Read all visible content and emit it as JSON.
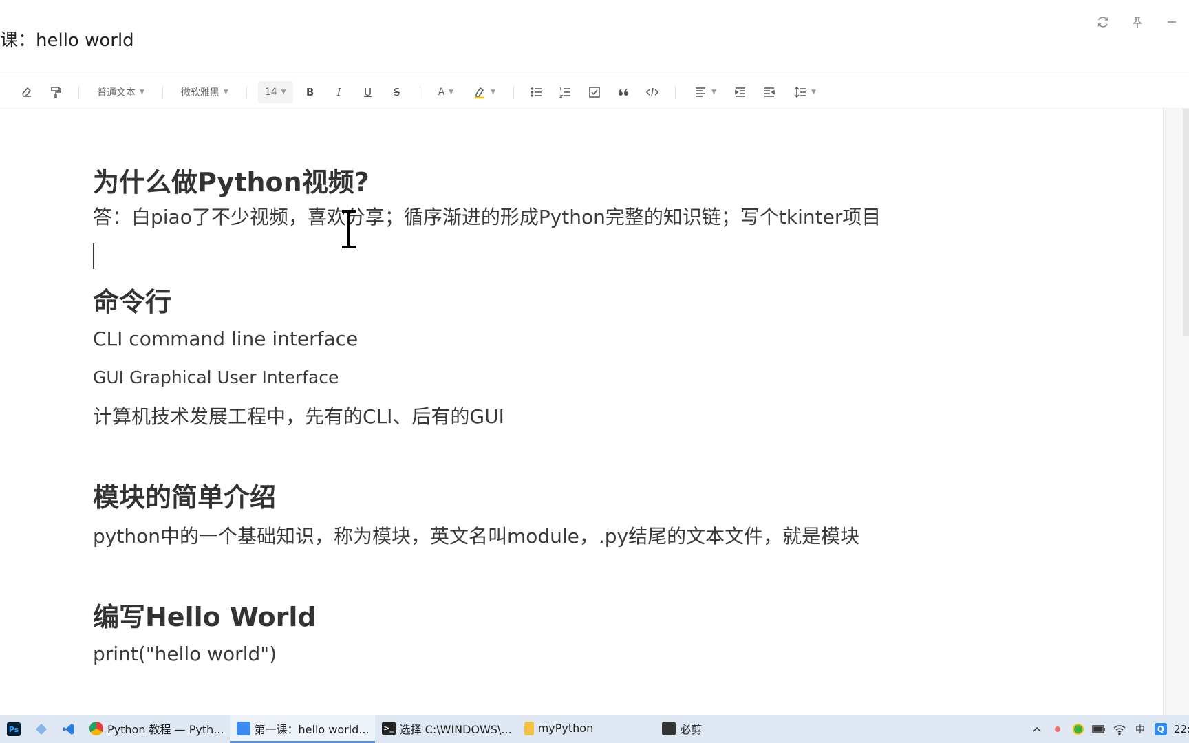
{
  "window": {
    "title": "课：hello world",
    "controls": [
      "refresh-icon",
      "pin-icon",
      "minimize-icon"
    ]
  },
  "toolbar": {
    "text_style": "普通文本",
    "font_family": "微软雅黑",
    "font_size": "14",
    "bold": "B",
    "italic": "I",
    "underline": "U",
    "strike": "S",
    "font_color": "A"
  },
  "document": {
    "sections": [
      {
        "heading": "为什么做Python视频?",
        "paragraphs": [
          "答：白piao了不少视频，喜欢分享；循序渐进的形成Python完整的知识链；写个tkinter项目"
        ]
      },
      {
        "heading": "命令行",
        "paragraphs": [
          "CLI command line interface",
          "GUI Graphical User Interface",
          "计算机技术发展工程中，先有的CLI、后有的GUI"
        ]
      },
      {
        "heading": "模块的简单介绍",
        "paragraphs": [
          "python中的一个基础知识，称为模块，英文名叫module，.py结尾的文本文件，就是模块"
        ]
      },
      {
        "heading": "编写Hello World",
        "paragraphs": [
          "print(\"hello world\")"
        ]
      }
    ]
  },
  "taskbar": {
    "apps": [
      {
        "label": "Python 教程 — Pyth...",
        "icon": "chrome-icon"
      },
      {
        "label": "第一课：hello world...",
        "icon": "notes-app-icon"
      },
      {
        "label": "选择 C:\\WINDOWS\\...",
        "icon": "cmd-icon"
      },
      {
        "label": "myPython",
        "icon": "folder-icon"
      },
      {
        "label": "必剪",
        "icon": "bijian-icon"
      }
    ],
    "pinned": [
      {
        "label": "Ps",
        "icon": "photoshop-icon"
      }
    ],
    "tray": {
      "ime": "中",
      "clock": "22:"
    }
  },
  "colors": {
    "taskbar_bg": "#dfe8f2",
    "active_underline": "#5a8fd6",
    "heading": "#333333"
  }
}
